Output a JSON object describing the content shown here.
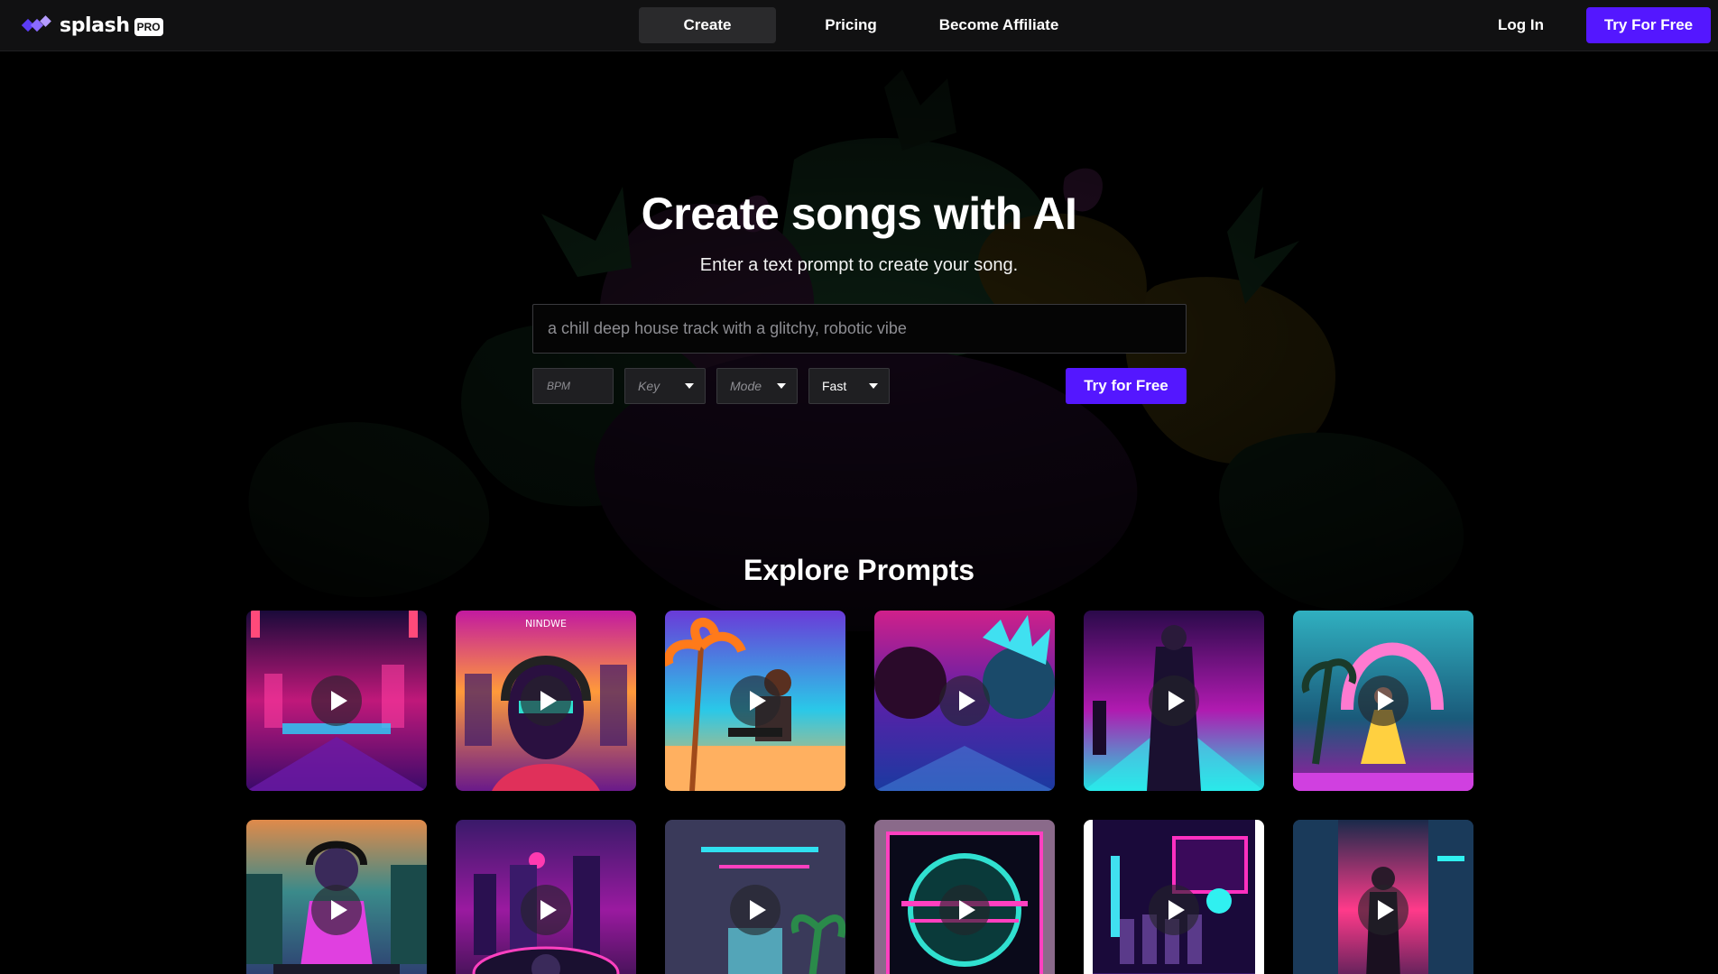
{
  "brand": {
    "name": "splash",
    "badge": "PRO",
    "accent": "#5417ff"
  },
  "nav": {
    "items": [
      {
        "label": "Create",
        "active": true
      },
      {
        "label": "Pricing"
      },
      {
        "label": "Become Affiliate"
      }
    ],
    "login": "Log In",
    "cta": "Try For Free"
  },
  "hero": {
    "title": "Create songs with AI",
    "subtitle": "Enter a text prompt to create your song.",
    "prompt_placeholder": "a chill deep house track with a glitchy, robotic vibe",
    "options": {
      "bpm_placeholder": "BPM",
      "key_placeholder": "Key",
      "mode_placeholder": "Mode",
      "speed_value": "Fast"
    },
    "cta": "Try for Free"
  },
  "explore": {
    "title": "Explore Prompts",
    "cards": [
      {
        "name": "card-synthwave-city-walker"
      },
      {
        "name": "card-headphones-portrait",
        "caption": "NINDWE"
      },
      {
        "name": "card-palm-beach-keyboardist"
      },
      {
        "name": "card-neon-skulls"
      },
      {
        "name": "card-trenchcoat-figure"
      },
      {
        "name": "card-neon-arc-dancer"
      },
      {
        "name": "card-dj-headphones"
      },
      {
        "name": "card-turntable-skyline"
      },
      {
        "name": "card-neon-room-plants"
      },
      {
        "name": "card-retro-circle-emblem"
      },
      {
        "name": "card-band-neon-building"
      },
      {
        "name": "card-neon-alley-figure"
      }
    ]
  }
}
